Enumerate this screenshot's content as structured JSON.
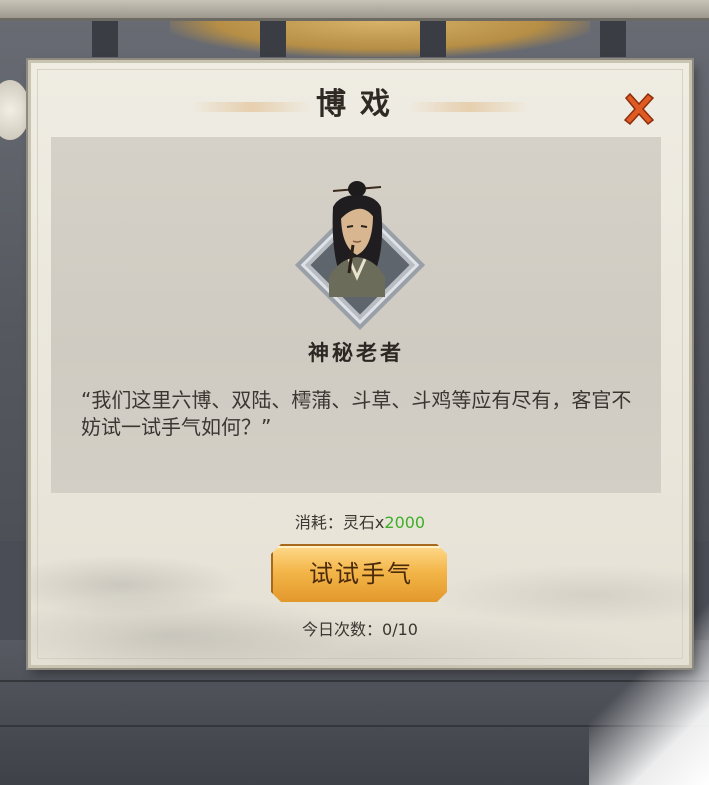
{
  "dialog": {
    "title": "博戏",
    "npc_name": "神秘老者",
    "quote": "“我们这里六博、双陆、樗蒲、斗草、斗鸡等应有尽有，客官不妨试一试手气如何？”"
  },
  "cost": {
    "label": "消耗：",
    "item": "灵石",
    "multiplier": "x",
    "amount": "2000"
  },
  "action": {
    "button_label": "试试手气"
  },
  "daily": {
    "label": "今日次数：",
    "used": "0",
    "separator": "/",
    "total": "10"
  },
  "colors": {
    "cost_amount": "#3fae2a",
    "close_icon": "#e05a24",
    "button_gold": "#f3b548"
  },
  "icons": {
    "close": "close-x-icon",
    "portrait": "old-man-portrait-icon"
  }
}
